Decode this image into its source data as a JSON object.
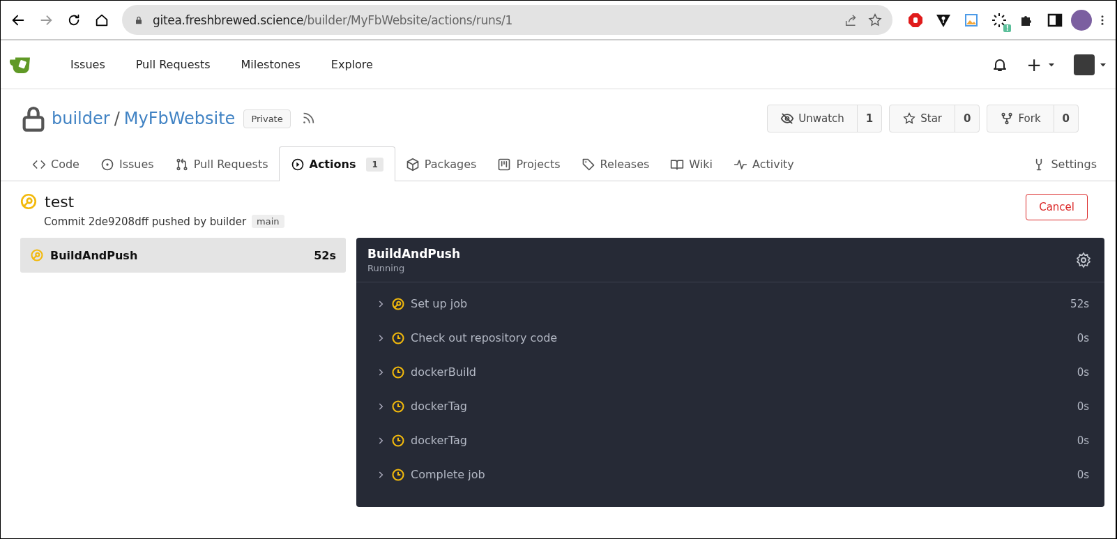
{
  "browser": {
    "url_host": "gitea.freshbrewed.science",
    "url_path": "/builder/MyFbWebsite/actions/runs/1",
    "extension_badge": "!"
  },
  "navbar": {
    "items": [
      {
        "label": "Issues"
      },
      {
        "label": "Pull Requests"
      },
      {
        "label": "Milestones"
      },
      {
        "label": "Explore"
      }
    ],
    "plus": "+"
  },
  "repo": {
    "owner": "builder",
    "separator": "/",
    "name": "MyFbWebsite",
    "visibility": "Private",
    "actions": [
      {
        "kind": "watch",
        "label": "Unwatch",
        "count": "1"
      },
      {
        "kind": "star",
        "label": "Star",
        "count": "0"
      },
      {
        "kind": "fork",
        "label": "Fork",
        "count": "0"
      }
    ]
  },
  "tabs": [
    {
      "kind": "code",
      "label": "Code",
      "selected": false
    },
    {
      "kind": "issues",
      "label": "Issues",
      "selected": false
    },
    {
      "kind": "pulls",
      "label": "Pull Requests",
      "selected": false
    },
    {
      "kind": "actions",
      "label": "Actions",
      "count": "1",
      "selected": true
    },
    {
      "kind": "packages",
      "label": "Packages",
      "selected": false
    },
    {
      "kind": "projects",
      "label": "Projects",
      "selected": false
    },
    {
      "kind": "releases",
      "label": "Releases",
      "selected": false
    },
    {
      "kind": "wiki",
      "label": "Wiki",
      "selected": false
    },
    {
      "kind": "activity",
      "label": "Activity",
      "selected": false
    },
    {
      "kind": "settings",
      "label": "Settings",
      "selected": false
    }
  ],
  "run": {
    "title": "test",
    "kind": "running",
    "commit_text": "Commit 2de9208dff pushed by builder",
    "branch": "main",
    "cancel": "Cancel"
  },
  "jobs": [
    {
      "name": "BuildAndPush",
      "duration": "52s",
      "kind": "running",
      "selected": true
    }
  ],
  "job_panel": {
    "title": "BuildAndPush",
    "status_text": "Running",
    "steps": [
      {
        "name": "Set up job",
        "duration": "52s",
        "kind": "running",
        "expanded": false
      },
      {
        "name": "Check out repository code",
        "duration": "0s",
        "kind": "waiting",
        "expanded": false
      },
      {
        "name": "dockerBuild",
        "duration": "0s",
        "kind": "waiting",
        "expanded": false
      },
      {
        "name": "dockerTag",
        "duration": "0s",
        "kind": "waiting",
        "expanded": false
      },
      {
        "name": "dockerTag",
        "duration": "0s",
        "kind": "waiting",
        "expanded": false
      },
      {
        "name": "Complete job",
        "duration": "0s",
        "kind": "waiting",
        "expanded": false
      }
    ]
  }
}
